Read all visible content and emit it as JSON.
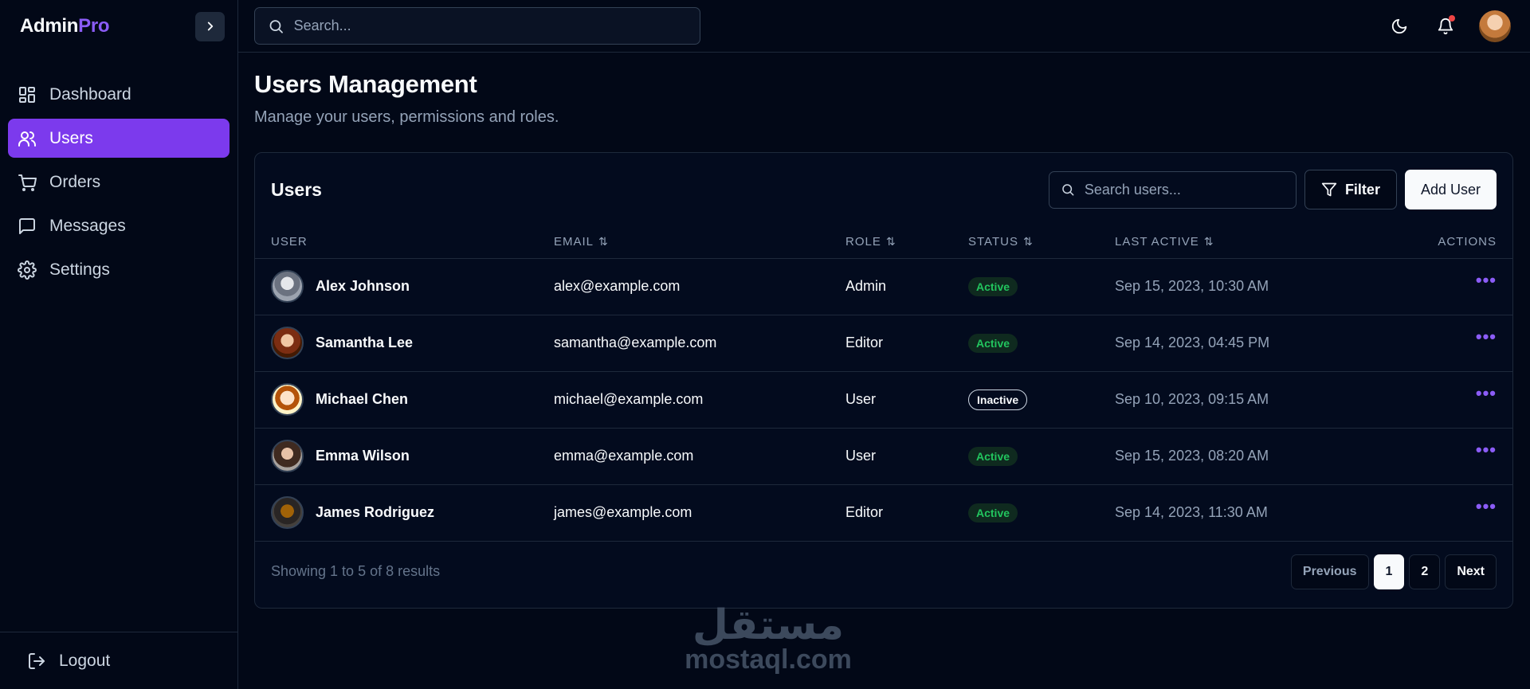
{
  "brand": {
    "name_main": "Admin",
    "name_accent": "Pro",
    "accent_color": "#8b5cf6"
  },
  "sidebar": {
    "items": [
      {
        "label": "Dashboard",
        "icon": "grid-icon"
      },
      {
        "label": "Users",
        "icon": "users-icon",
        "active": true
      },
      {
        "label": "Orders",
        "icon": "cart-icon"
      },
      {
        "label": "Messages",
        "icon": "message-icon"
      },
      {
        "label": "Settings",
        "icon": "gear-icon"
      }
    ],
    "logout_label": "Logout"
  },
  "topbar": {
    "search_placeholder": "Search..."
  },
  "page": {
    "title": "Users Management",
    "subtitle": "Manage your users, permissions and roles."
  },
  "card": {
    "title": "Users",
    "search_placeholder": "Search users...",
    "filter_label": "Filter",
    "add_label": "Add User"
  },
  "table": {
    "headers": {
      "user": "USER",
      "email": "EMAIL",
      "role": "ROLE",
      "status": "STATUS",
      "last_active": "LAST ACTIVE",
      "actions": "ACTIONS"
    },
    "rows": [
      {
        "name": "Alex Johnson",
        "email": "alex@example.com",
        "role": "Admin",
        "status": "Active",
        "last_active": "Sep 15, 2023, 10:30 AM",
        "actions": "•••"
      },
      {
        "name": "Samantha Lee",
        "email": "samantha@example.com",
        "role": "Editor",
        "status": "Active",
        "last_active": "Sep 14, 2023, 04:45 PM",
        "actions": "•••"
      },
      {
        "name": "Michael Chen",
        "email": "michael@example.com",
        "role": "User",
        "status": "Inactive",
        "last_active": "Sep 10, 2023, 09:15 AM",
        "actions": "•••"
      },
      {
        "name": "Emma Wilson",
        "email": "emma@example.com",
        "role": "User",
        "status": "Active",
        "last_active": "Sep 15, 2023, 08:20 AM",
        "actions": "•••"
      },
      {
        "name": "James Rodriguez",
        "email": "james@example.com",
        "role": "Editor",
        "status": "Active",
        "last_active": "Sep 14, 2023, 11:30 AM",
        "actions": "•••"
      }
    ]
  },
  "footer": {
    "showing": "Showing 1 to 5 of 8 results",
    "prev_label": "Previous",
    "pages": [
      "1",
      "2"
    ],
    "current_page": "1",
    "next_label": "Next"
  },
  "watermark": {
    "arabic": "مستقل",
    "latin": "mostaql.com"
  }
}
